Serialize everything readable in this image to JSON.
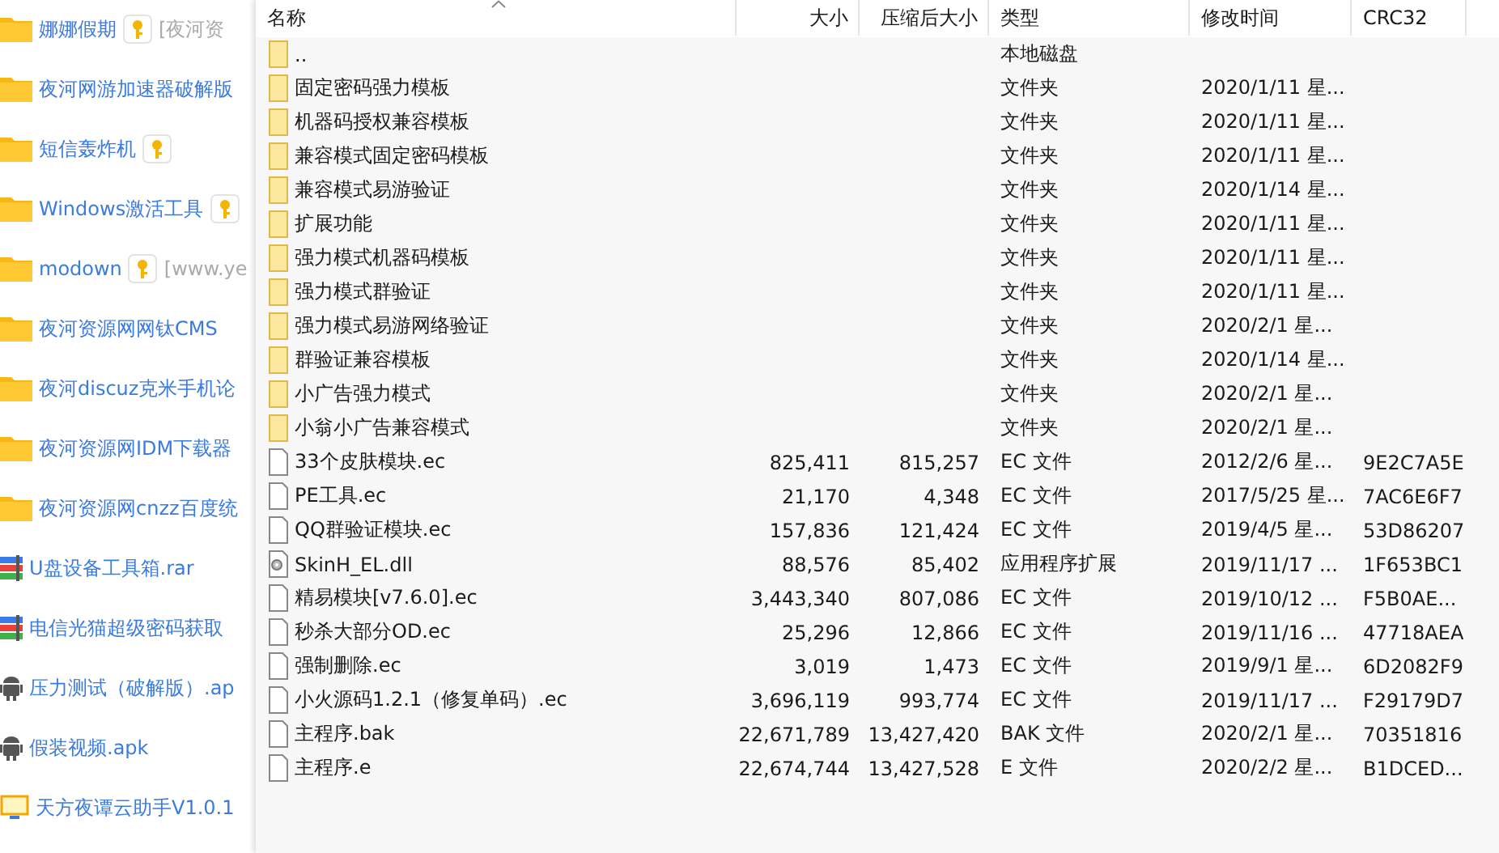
{
  "web_list": {
    "items": [
      {
        "kind": "folder",
        "name": "娜娜假期",
        "has_key": true,
        "note": "[夜河资"
      },
      {
        "kind": "folder",
        "name": "夜河网游加速器破解版",
        "has_key": false
      },
      {
        "kind": "folder",
        "name": "短信轰炸机",
        "has_key": true
      },
      {
        "kind": "folder",
        "name": "Windows激活工具",
        "has_key": true
      },
      {
        "kind": "folder",
        "name": "modown",
        "has_key": true,
        "note": "[www.ye"
      },
      {
        "kind": "folder",
        "name": "夜河资源网网钛CMS",
        "has_key": false
      },
      {
        "kind": "folder",
        "name": "夜河discuz克米手机论",
        "has_key": false
      },
      {
        "kind": "folder",
        "name": "夜河资源网IDM下载器",
        "has_key": false
      },
      {
        "kind": "folder",
        "name": "夜河资源网cnzz百度统",
        "has_key": false
      },
      {
        "kind": "archive",
        "name": "U盘设备工具箱.rar",
        "has_key": false
      },
      {
        "kind": "archive",
        "name": "电信光猫超级密码获取",
        "has_key": false
      },
      {
        "kind": "android",
        "name": "压力测试（破解版）.ap",
        "has_key": false
      },
      {
        "kind": "android",
        "name": "假装视频.apk",
        "has_key": false
      },
      {
        "kind": "app",
        "name": "天方夜谭云助手V1.0.1",
        "has_key": false
      }
    ]
  },
  "file_list": {
    "columns": [
      {
        "label": "名称",
        "sorted": true
      },
      {
        "label": "大小",
        "sorted": false
      },
      {
        "label": "压缩后大小",
        "sorted": false
      },
      {
        "label": "类型",
        "sorted": false
      },
      {
        "label": "修改时间",
        "sorted": false
      },
      {
        "label": "CRC32",
        "sorted": false
      }
    ],
    "rows": [
      {
        "kind": "folder",
        "name": "..",
        "type": "本地磁盘"
      },
      {
        "kind": "folder",
        "name": "固定密码强力模板",
        "type": "文件夹",
        "modified": "2020/1/11 星..."
      },
      {
        "kind": "folder",
        "name": "机器码授权兼容模板",
        "type": "文件夹",
        "modified": "2020/1/11 星..."
      },
      {
        "kind": "folder",
        "name": "兼容模式固定密码模板",
        "type": "文件夹",
        "modified": "2020/1/11 星..."
      },
      {
        "kind": "folder",
        "name": "兼容模式易游验证",
        "type": "文件夹",
        "modified": "2020/1/14 星..."
      },
      {
        "kind": "folder",
        "name": "扩展功能",
        "type": "文件夹",
        "modified": "2020/1/11 星..."
      },
      {
        "kind": "folder",
        "name": "强力模式机器码模板",
        "type": "文件夹",
        "modified": "2020/1/11 星..."
      },
      {
        "kind": "folder",
        "name": "强力模式群验证",
        "type": "文件夹",
        "modified": "2020/1/11 星..."
      },
      {
        "kind": "folder",
        "name": "强力模式易游网络验证",
        "type": "文件夹",
        "modified": "2020/2/1 星..."
      },
      {
        "kind": "folder",
        "name": "群验证兼容模板",
        "type": "文件夹",
        "modified": "2020/1/14 星..."
      },
      {
        "kind": "folder",
        "name": "小广告强力模式",
        "type": "文件夹",
        "modified": "2020/2/1 星..."
      },
      {
        "kind": "folder",
        "name": "小翁小广告兼容模式",
        "type": "文件夹",
        "modified": "2020/2/1 星..."
      },
      {
        "kind": "file",
        "name": "33个皮肤模块.ec",
        "size": "825,411",
        "packed": "815,257",
        "type": "EC 文件",
        "modified": "2012/2/6 星...",
        "crc": "9E2C7A5E"
      },
      {
        "kind": "file",
        "name": "PE工具.ec",
        "size": "21,170",
        "packed": "4,348",
        "type": "EC 文件",
        "modified": "2017/5/25 星...",
        "crc": "7AC6E6F7"
      },
      {
        "kind": "file",
        "name": "QQ群验证模块.ec",
        "size": "157,836",
        "packed": "121,424",
        "type": "EC 文件",
        "modified": "2019/4/5 星...",
        "crc": "53D86207"
      },
      {
        "kind": "library",
        "name": "SkinH_EL.dll",
        "size": "88,576",
        "packed": "85,402",
        "type": "应用程序扩展",
        "modified": "2019/11/17 ...",
        "crc": "1F653BC1"
      },
      {
        "kind": "file",
        "name": "精易模块[v7.6.0].ec",
        "size": "3,443,340",
        "packed": "807,086",
        "type": "EC 文件",
        "modified": "2019/10/12 ...",
        "crc": "F5B0AE..."
      },
      {
        "kind": "file",
        "name": "秒杀大部分OD.ec",
        "size": "25,296",
        "packed": "12,866",
        "type": "EC 文件",
        "modified": "2019/11/16 ...",
        "crc": "47718AEA"
      },
      {
        "kind": "file",
        "name": "强制删除.ec",
        "size": "3,019",
        "packed": "1,473",
        "type": "EC 文件",
        "modified": "2019/9/1 星...",
        "crc": "6D2082F9"
      },
      {
        "kind": "file",
        "name": "小火源码1.2.1（修复单码）.ec",
        "size": "3,696,119",
        "packed": "993,774",
        "type": "EC 文件",
        "modified": "2019/11/17 ...",
        "crc": "F29179D7"
      },
      {
        "kind": "file",
        "name": "主程序.bak",
        "size": "22,671,789",
        "packed": "13,427,420",
        "type": "BAK 文件",
        "modified": "2020/2/1 星...",
        "crc": "70351816"
      },
      {
        "kind": "file",
        "name": "主程序.e",
        "size": "22,674,744",
        "packed": "13,427,528",
        "type": "E 文件",
        "modified": "2020/2/2 星...",
        "crc": "B1DCED..."
      }
    ]
  }
}
